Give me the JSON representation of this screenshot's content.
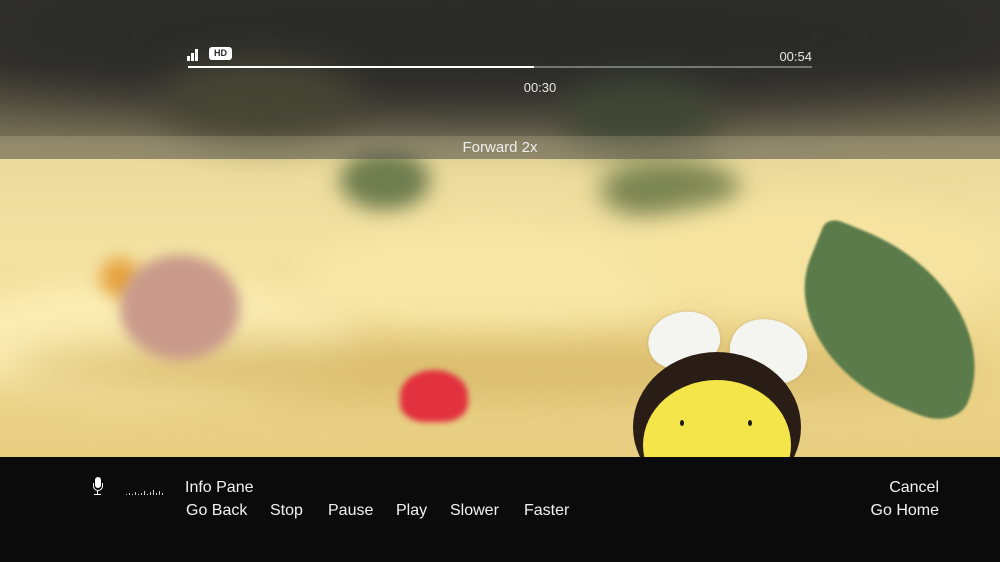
{
  "player": {
    "quality_badge": "HD",
    "total_time": "00:54",
    "current_time": "00:30",
    "progress_fraction": 0.555,
    "icons": {
      "signal": "signal-strength-icon",
      "microphone": "microphone-icon",
      "voice_level": "voice-level-meter-icon"
    }
  },
  "playback_status": {
    "label": "Forward 2x"
  },
  "voice_commands": {
    "top_row": [
      "Info Pane"
    ],
    "bottom_row": [
      "Go Back",
      "Stop",
      "Pause",
      "Play",
      "Slower",
      "Faster"
    ],
    "right_top": "Cancel",
    "right_bottom": "Go Home"
  },
  "colors": {
    "command_bar_bg": "#0b0b0b",
    "text": "#f2f2f2",
    "progress_fill": "#ffffff"
  }
}
